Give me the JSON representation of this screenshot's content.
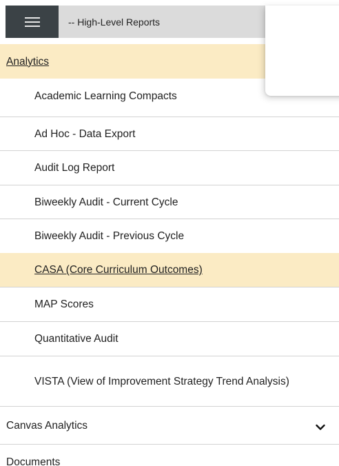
{
  "header": {
    "menu_icon": "hamburger-menu-icon",
    "report_select_value": "-- High-Level Reports"
  },
  "nav": {
    "analytics": {
      "label": "Analytics",
      "items": [
        "Academic Learning Compacts",
        "Ad Hoc - Data Export",
        "Audit Log Report",
        "Biweekly Audit - Current Cycle",
        "Biweekly Audit - Previous Cycle",
        "CASA (Core Curriculum Outcomes)",
        "MAP Scores",
        "Quantitative Audit",
        "VISTA (View of Improvement Strategy Trend Analysis)"
      ],
      "selected_item": "CASA (Core Curriculum Outcomes)"
    },
    "canvas_analytics": {
      "label": "Canvas Analytics",
      "icon": "chevron-down-icon"
    },
    "documents": {
      "label": "Documents"
    }
  },
  "colors": {
    "menu_button_bg": "#3b4246",
    "select_bg": "#dbdbdb",
    "highlight_bg": "#fbebc4",
    "divider": "#d2d2d2"
  }
}
